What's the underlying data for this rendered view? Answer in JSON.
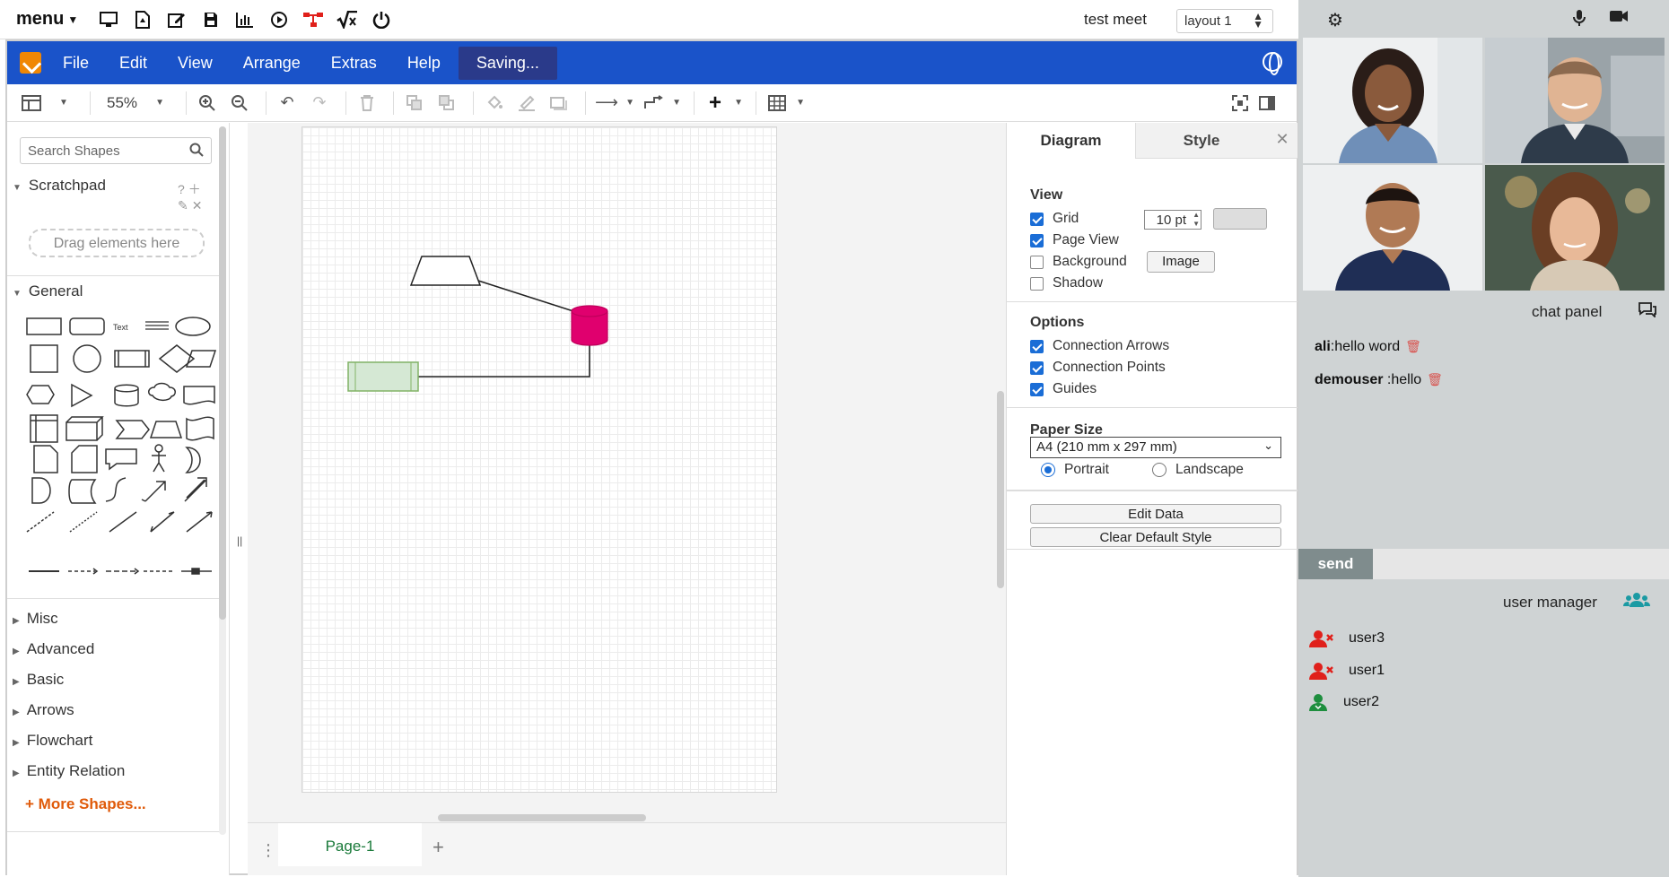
{
  "topbar": {
    "menu_label": "menu",
    "meeting_name": "test meet",
    "layout_value": "layout 1",
    "icons": [
      "monitor-icon",
      "pdf-icon",
      "edit-icon",
      "save-icon",
      "chart-icon",
      "play-icon",
      "share-icon",
      "formula-icon",
      "power-icon"
    ]
  },
  "drawio": {
    "menus": [
      "File",
      "Edit",
      "View",
      "Arrange",
      "Extras",
      "Help"
    ],
    "status": "Saving...",
    "zoom": "55%",
    "search_placeholder": "Search Shapes",
    "scratchpad_title": "Scratchpad",
    "drop_hint": "Drag elements here",
    "general_title": "General",
    "shape_text_label": "Text",
    "categories": [
      "Misc",
      "Advanced",
      "Basic",
      "Arrows",
      "Flowchart",
      "Entity Relation"
    ],
    "more_shapes": "More Shapes...",
    "page_tab": "Page-1"
  },
  "diagram": {
    "trapezoid_fill": "#ffffff",
    "cylinder_fill": "#e0006e",
    "rectangle_fill": "#d5e8d4",
    "rectangle_stroke": "#82b366"
  },
  "format_panel": {
    "tabs": [
      "Diagram",
      "Style"
    ],
    "view_title": "View",
    "grid_label": "Grid",
    "grid_size": "10 pt",
    "page_view_label": "Page View",
    "background_label": "Background",
    "image_button": "Image",
    "shadow_label": "Shadow",
    "options_title": "Options",
    "connection_arrows": "Connection Arrows",
    "connection_points": "Connection Points",
    "guides": "Guides",
    "paper_size_title": "Paper Size",
    "paper_size_value": "A4 (210 mm x 297 mm)",
    "portrait": "Portrait",
    "landscape": "Landscape",
    "edit_data": "Edit Data",
    "clear_default_style": "Clear Default Style",
    "checks": {
      "grid": true,
      "page_view": true,
      "background": false,
      "shadow": false,
      "connection_arrows": true,
      "connection_points": true,
      "guides": true
    },
    "orientation": "portrait"
  },
  "side": {
    "chat_title": "chat panel",
    "messages": [
      {
        "user": "ali",
        "text": ":hello word"
      },
      {
        "user": "demouser",
        "text": ":hello"
      }
    ],
    "send_label": "send",
    "user_manager_title": "user manager",
    "users": [
      {
        "name": "user3",
        "status": "red"
      },
      {
        "name": "user1",
        "status": "red"
      },
      {
        "name": "user2",
        "status": "green"
      }
    ],
    "colors": {
      "accent": "#1a53c9",
      "online": "#1e8e3e",
      "offline": "#e0201b"
    }
  }
}
